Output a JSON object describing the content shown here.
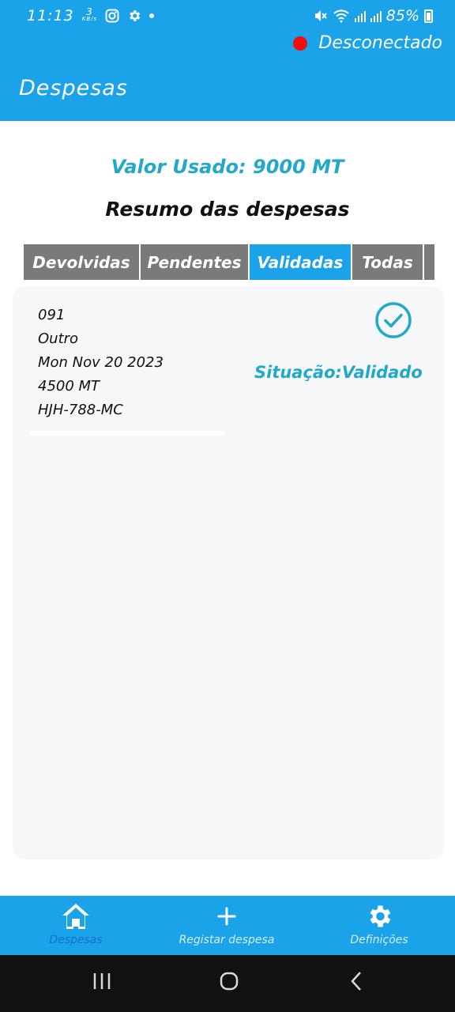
{
  "status_bar": {
    "time": "11:13",
    "net_speed_value": "3",
    "net_speed_unit": "KB/s",
    "battery": "85%"
  },
  "app_bar": {
    "connection_status": "Desconectado",
    "connection_color": "#f00f0f",
    "title": "Despesas"
  },
  "summary": {
    "valor_usado": "Valor Usado: 9000 MT",
    "heading": "Resumo das despesas"
  },
  "tabs": [
    {
      "label": "Devolvidas",
      "active": false
    },
    {
      "label": "Pendentes",
      "active": false
    },
    {
      "label": "Validadas",
      "active": true
    },
    {
      "label": "Todas",
      "active": false
    }
  ],
  "expense": {
    "lines": [
      "091",
      "Outro",
      "Mon Nov 20 2023",
      "4500 MT",
      "HJH-788-MC"
    ],
    "status": "Situação:Validado",
    "icon": "check-circle-icon"
  },
  "bottom_nav": [
    {
      "label": "Despesas",
      "icon": "home-icon",
      "active": true
    },
    {
      "label": "Registar despesa",
      "icon": "plus-icon",
      "active": false
    },
    {
      "label": "Definições",
      "icon": "gear-icon",
      "active": false
    }
  ],
  "colors": {
    "primary": "#1aa3e8",
    "accent_text": "#22a8c8",
    "tab_inactive": "#7a7a7a",
    "nav_active": "#1670d8"
  }
}
